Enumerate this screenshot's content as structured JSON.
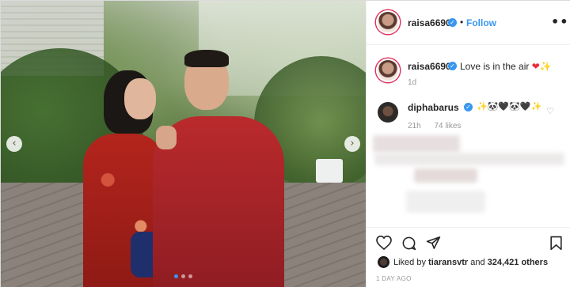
{
  "post": {
    "author": "raisa6690",
    "follow_label": "Follow",
    "separator": "•",
    "more_label": "•••",
    "verified_mark": "✓",
    "carousel": {
      "slide_count": 3,
      "active_index": 0
    }
  },
  "caption": {
    "username": "raisa6690",
    "text": "Love is in the air ",
    "emoji_heart": "❤",
    "emoji_sparkle": "✨",
    "time": "1d"
  },
  "comment": {
    "username": "diphabarus",
    "emojis": "✨🐼🖤🐼🖤✨",
    "time": "21h",
    "likes": "74 likes"
  },
  "likes": {
    "prefix": "Liked by ",
    "user": "tiaransvtr",
    "middle": " and ",
    "count": "324,421 others"
  },
  "timestamp": "1 DAY AGO",
  "icons": {
    "prev": "‹",
    "next": "›",
    "comment_heart": "♡"
  },
  "colors": {
    "accent": "#3897f0",
    "heart": "#ed2b3b",
    "text": "#262626",
    "muted": "#999999"
  }
}
